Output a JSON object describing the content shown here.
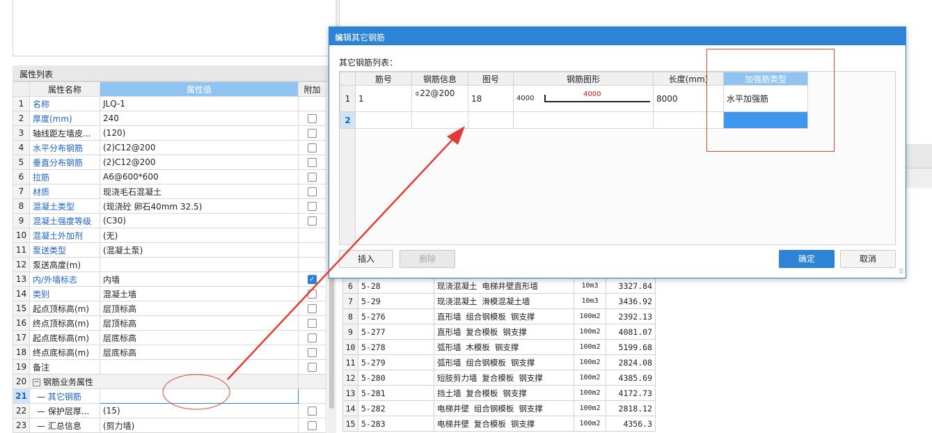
{
  "property_panel": {
    "title": "属性列表",
    "headers": {
      "name": "属性名称",
      "value": "属性值",
      "extra": "附加"
    },
    "rows": [
      {
        "num": "1",
        "name": "名称",
        "value": "JLQ-1",
        "blue": true,
        "check": "none"
      },
      {
        "num": "2",
        "name": "厚度(mm)",
        "value": "240",
        "blue": true,
        "check": "off"
      },
      {
        "num": "3",
        "name": "轴线距左墙皮...",
        "value": "(120)",
        "blue": false,
        "check": "off"
      },
      {
        "num": "4",
        "name": "水平分布钢筋",
        "value": "(2)C12@200",
        "blue": true,
        "check": "off"
      },
      {
        "num": "5",
        "name": "垂直分布钢筋",
        "value": "(2)C12@200",
        "blue": true,
        "check": "off"
      },
      {
        "num": "6",
        "name": "拉筋",
        "value": "A6@600*600",
        "blue": true,
        "check": "off"
      },
      {
        "num": "7",
        "name": "材质",
        "value": "现浇毛石混凝土",
        "blue": true,
        "check": "off"
      },
      {
        "num": "8",
        "name": "混凝土类型",
        "value": "(现浇砼 卵石40mm 32.5)",
        "blue": true,
        "check": "off"
      },
      {
        "num": "9",
        "name": "混凝土强度等级",
        "value": "(C30)",
        "blue": true,
        "check": "off"
      },
      {
        "num": "10",
        "name": "混凝土外加剂",
        "value": "(无)",
        "blue": true,
        "check": "none"
      },
      {
        "num": "11",
        "name": "泵送类型",
        "value": "(混凝土泵)",
        "blue": true,
        "check": "none"
      },
      {
        "num": "12",
        "name": "泵送高度(m)",
        "value": "",
        "blue": false,
        "check": "none"
      },
      {
        "num": "13",
        "name": "内/外墙标志",
        "value": "内墙",
        "blue": true,
        "check": "on"
      },
      {
        "num": "14",
        "name": "类别",
        "value": "混凝土墙",
        "blue": true,
        "check": "off"
      },
      {
        "num": "15",
        "name": "起点顶标高(m)",
        "value": "层顶标高",
        "blue": false,
        "check": "off"
      },
      {
        "num": "16",
        "name": "终点顶标高(m)",
        "value": "层顶标高",
        "blue": false,
        "check": "off"
      },
      {
        "num": "17",
        "name": "起点底标高(m)",
        "value": "层底标高",
        "blue": false,
        "check": "off"
      },
      {
        "num": "18",
        "name": "终点底标高(m)",
        "value": "层底标高",
        "blue": false,
        "check": "off"
      },
      {
        "num": "19",
        "name": "备注",
        "value": "",
        "blue": false,
        "check": "off"
      }
    ],
    "group": {
      "num": "20",
      "toggle": "−",
      "label": "钢筋业务属性"
    },
    "sub_rows": [
      {
        "num": "21",
        "name": "其它钢筋",
        "value": "",
        "selected": true,
        "ellipsis": "···"
      },
      {
        "num": "22",
        "name": "保护层厚...",
        "value": "(15)",
        "check": "off"
      },
      {
        "num": "23",
        "name": "汇总信息",
        "value": "(剪力墙)",
        "check": "off"
      }
    ]
  },
  "dialog": {
    "title": "编辑其它钢筋",
    "close": "×",
    "list_label": "其它钢筋列表：",
    "headers": [
      "筋号",
      "钢筋信息",
      "图号",
      "钢筋图形",
      "长度(mm)",
      "加强筋类型"
    ],
    "rows": [
      {
        "num": "1",
        "bar_no": "1",
        "info": "⌽22@200",
        "fig_no": "18",
        "shape_left": "4000",
        "shape_mid": "4000",
        "length": "8000",
        "type": "水平加强筋"
      },
      {
        "num": "2",
        "bar_no": "",
        "info": "",
        "fig_no": "",
        "shape_left": "",
        "shape_mid": "",
        "length": "",
        "type": ""
      }
    ],
    "buttons": {
      "insert": "插入",
      "delete": "删除",
      "ok": "确定",
      "cancel": "取消"
    }
  },
  "quota_table": {
    "rows": [
      {
        "num": "6",
        "code": "5-28",
        "name": "现浇混凝土 电梯井壁直形墙",
        "unit": "10m3",
        "price": "3327.84"
      },
      {
        "num": "7",
        "code": "5-29",
        "name": "现浇混凝土 滑模混凝土墙",
        "unit": "10m3",
        "price": "3436.92"
      },
      {
        "num": "8",
        "code": "5-276",
        "name": "直形墙 组合钢模板 钢支撑",
        "unit": "100m2",
        "price": "2392.13"
      },
      {
        "num": "9",
        "code": "5-277",
        "name": "直形墙 复合模板 钢支撑",
        "unit": "100m2",
        "price": "4081.07"
      },
      {
        "num": "10",
        "code": "5-278",
        "name": "弧形墙 木模板 钢支撑",
        "unit": "100m2",
        "price": "5199.68"
      },
      {
        "num": "11",
        "code": "5-279",
        "name": "弧形墙 组合钢模板 钢支撑",
        "unit": "100m2",
        "price": "2824.08"
      },
      {
        "num": "12",
        "code": "5-280",
        "name": "短肢剪力墙 复合模板 钢支撑",
        "unit": "100m2",
        "price": "4385.69"
      },
      {
        "num": "13",
        "code": "5-281",
        "name": "挡土墙 复合模板 钢支撑",
        "unit": "100m2",
        "price": "4172.73"
      },
      {
        "num": "14",
        "code": "5-282",
        "name": "电梯井壁 组合钢模板 钢支撑",
        "unit": "100m2",
        "price": "2818.12"
      },
      {
        "num": "15",
        "code": "5-283",
        "name": "电梯井壁 复合模板 钢支撑",
        "unit": "100m2",
        "price": "4356.3"
      }
    ]
  },
  "annotation_colors": {
    "arrow": "#e53935",
    "ellipse": "#e2463a",
    "rect": "#e2463a"
  }
}
